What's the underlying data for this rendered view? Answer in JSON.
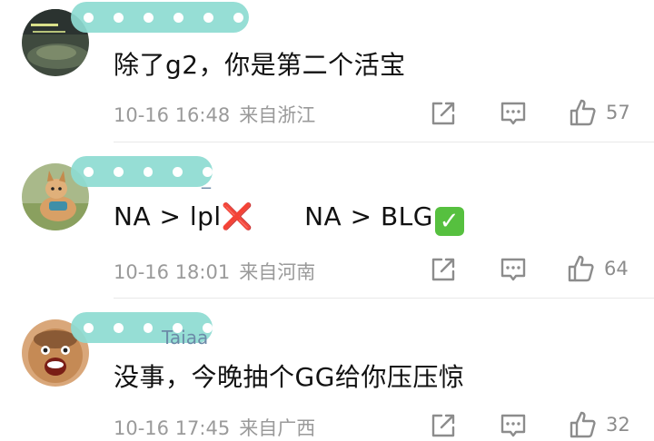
{
  "comments": [
    {
      "username_visible": "",
      "text": "除了g2，你是第二个活宝",
      "time": "10-16 16:48",
      "location": "来自浙江",
      "likes": "57"
    },
    {
      "username_visible": "_",
      "text_a": "NA > lpl",
      "text_a_mark": "❌",
      "text_b": "NA > BLG",
      "text_b_mark": "✓",
      "time": "10-16 18:01",
      "location": "来自河南",
      "likes": "64"
    },
    {
      "username_visible": "Taiaa",
      "text": "没事，今晚抽个GG给你压压惊",
      "time": "10-16 17:45",
      "location": "来自广西",
      "likes": "32"
    }
  ],
  "icons": {
    "share": "share-icon",
    "reply": "comment-icon",
    "like": "thumbs-up-icon"
  },
  "colors": {
    "text": "#111111",
    "meta": "#9a9a9a",
    "username_mask": "#8edcd2",
    "icon": "#8c8c8c"
  }
}
